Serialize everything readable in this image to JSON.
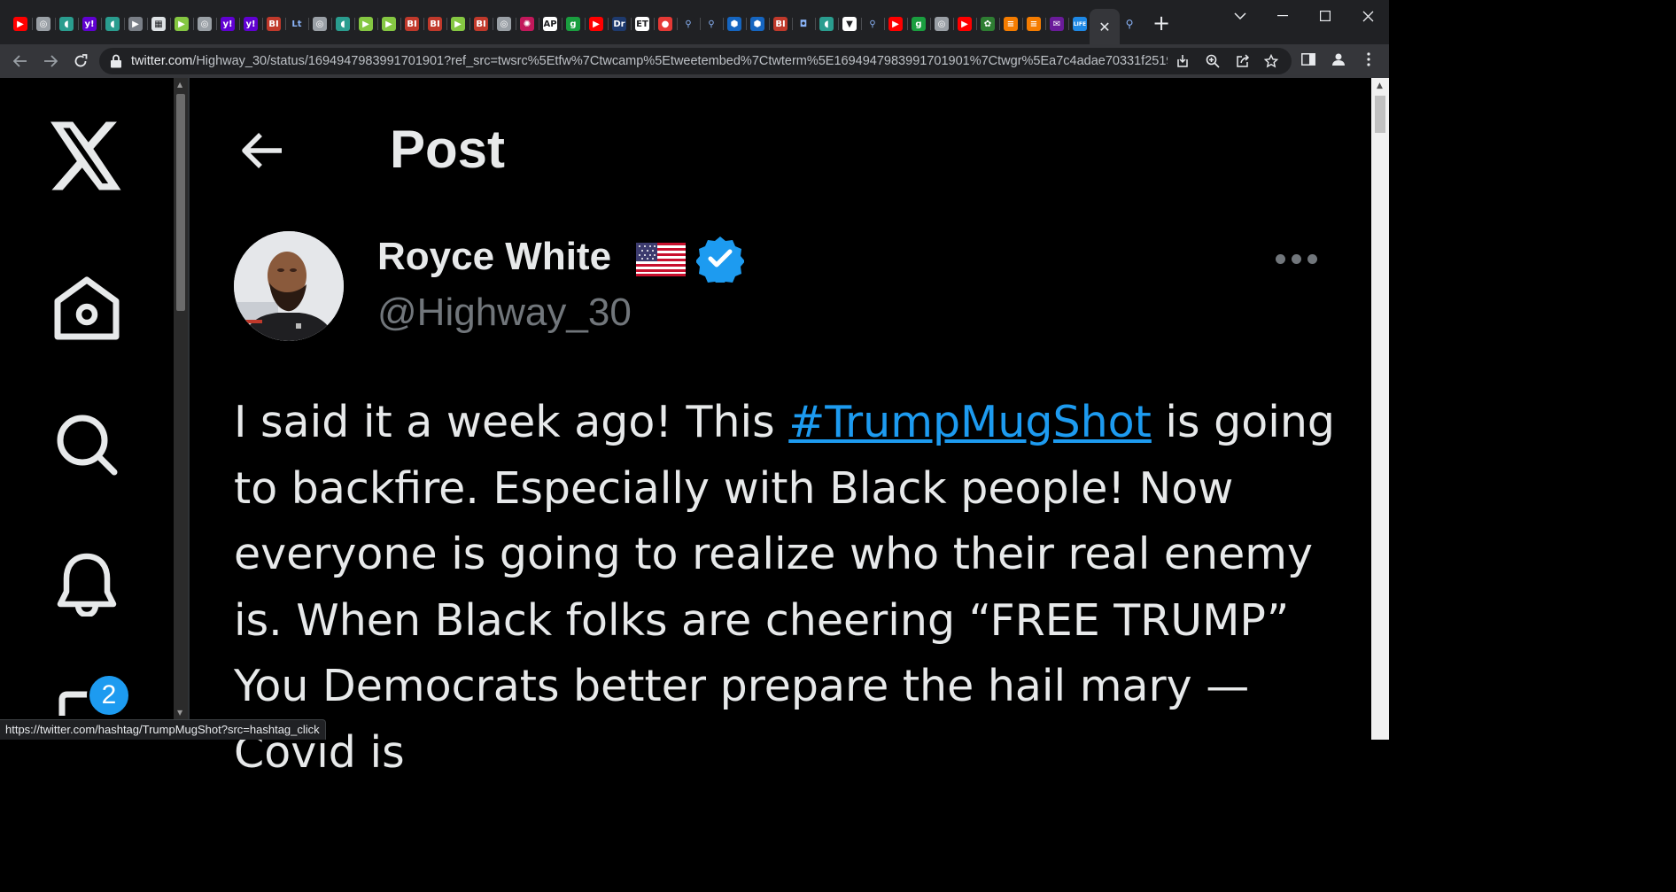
{
  "browser": {
    "url_host": "twitter.com",
    "url_path": "/Highway_30/status/1694947983991701901?ref_src=twsrc%5Etfw%7Ctwcamp%5Etweetembed%7Ctwterm%5E1694947983991701901%7Ctwgr%5Ea7c4adae70331f25193...",
    "tabs": [
      {
        "icon": "youtube-icon",
        "color": "#ff0000",
        "glyph": "▶"
      },
      {
        "icon": "globe-icon",
        "color": "#9aa0a6",
        "glyph": "◎"
      },
      {
        "icon": "shield-icon",
        "color": "#2a9d8f",
        "glyph": "◖"
      },
      {
        "icon": "yahoo-icon",
        "color": "#6001d2",
        "glyph": "y!"
      },
      {
        "icon": "shield-icon",
        "color": "#2a9d8f",
        "glyph": "◖"
      },
      {
        "icon": "tag-icon",
        "color": "#7a7f87",
        "glyph": "▶"
      },
      {
        "icon": "qr-icon",
        "color": "#dfe3e6",
        "glyph": "▦"
      },
      {
        "icon": "rumble-icon",
        "color": "#85c742",
        "glyph": "▶"
      },
      {
        "icon": "globe-icon",
        "color": "#9aa0a6",
        "glyph": "◎"
      },
      {
        "icon": "yahoo-icon",
        "color": "#6001d2",
        "glyph": "y!"
      },
      {
        "icon": "yahoo-icon",
        "color": "#6001d2",
        "glyph": "y!"
      },
      {
        "icon": "bi-icon",
        "color": "#c0392b",
        "glyph": "BI"
      },
      {
        "icon": "serif-logo-icon",
        "color": "#202124",
        "glyph": "Lt"
      },
      {
        "icon": "globe-icon",
        "color": "#9aa0a6",
        "glyph": "◎"
      },
      {
        "icon": "shield-icon",
        "color": "#2a9d8f",
        "glyph": "◖"
      },
      {
        "icon": "rumble-icon",
        "color": "#85c742",
        "glyph": "▶"
      },
      {
        "icon": "rumble-icon",
        "color": "#85c742",
        "glyph": "▶"
      },
      {
        "icon": "bi-icon",
        "color": "#c0392b",
        "glyph": "BI"
      },
      {
        "icon": "bi-icon",
        "color": "#c0392b",
        "glyph": "BI"
      },
      {
        "icon": "rumble-icon",
        "color": "#85c742",
        "glyph": "▶"
      },
      {
        "icon": "bi-icon",
        "color": "#c0392b",
        "glyph": "BI"
      },
      {
        "icon": "globe-icon",
        "color": "#9aa0a6",
        "glyph": "◎"
      },
      {
        "icon": "spiral-icon",
        "color": "#c2185b",
        "glyph": "✺"
      },
      {
        "icon": "news-icon",
        "color": "#ffffff",
        "glyph": "AP"
      },
      {
        "icon": "gettr-icon",
        "color": "#1a9e3f",
        "glyph": "g"
      },
      {
        "icon": "youtube-icon",
        "color": "#ff0000",
        "glyph": "▶"
      },
      {
        "icon": "dr-icon",
        "color": "#1e3a6e",
        "glyph": "Dr"
      },
      {
        "icon": "et-icon",
        "color": "#ffffff",
        "glyph": "ET"
      },
      {
        "icon": "mic-icon",
        "color": "#e53935",
        "glyph": "●"
      },
      {
        "icon": "search-icon",
        "color": "#202124",
        "glyph": "⚲"
      },
      {
        "icon": "search-icon",
        "color": "#202124",
        "glyph": "⚲"
      },
      {
        "icon": "hex-icon",
        "color": "#1565c0",
        "glyph": "⬢"
      },
      {
        "icon": "hex-icon",
        "color": "#1565c0",
        "glyph": "⬢"
      },
      {
        "icon": "bi-icon",
        "color": "#c0392b",
        "glyph": "BI"
      },
      {
        "icon": "shield-outline-icon",
        "color": "#202124",
        "glyph": "◘"
      },
      {
        "icon": "shield-icon",
        "color": "#2a9d8f",
        "glyph": "◖"
      },
      {
        "icon": "crest-icon",
        "color": "#ffffff",
        "glyph": "▼"
      },
      {
        "icon": "search-icon",
        "color": "#202124",
        "glyph": "⚲"
      },
      {
        "icon": "youtube-icon",
        "color": "#ff0000",
        "glyph": "▶"
      },
      {
        "icon": "gettr-icon",
        "color": "#1a9e3f",
        "glyph": "g"
      },
      {
        "icon": "globe-icon",
        "color": "#9aa0a6",
        "glyph": "◎"
      },
      {
        "icon": "youtube-icon",
        "color": "#ff0000",
        "glyph": "▶"
      },
      {
        "icon": "leaf-icon",
        "color": "#2e7d32",
        "glyph": "✿"
      },
      {
        "icon": "bookmark-icon",
        "color": "#f57c00",
        "glyph": "≡"
      },
      {
        "icon": "bookmark-icon",
        "color": "#f57c00",
        "glyph": "≡"
      },
      {
        "icon": "mail-icon",
        "color": "#6a1b9a",
        "glyph": "✉"
      },
      {
        "icon": "life-icon",
        "color": "#1e88e5",
        "glyph": "LIFE"
      }
    ]
  },
  "sidebar": {
    "badge_count": "2"
  },
  "header": {
    "title": "Post"
  },
  "author": {
    "name": "Royce White",
    "handle": "@Highway_30"
  },
  "tweet": {
    "text_before": "I said it a week ago! This ",
    "hashtag": "#TrumpMugShot",
    "text_after": " is going to backfire. Especially with Black people! Now everyone is going to realize who their real enemy is. When Black folks are cheering “FREE TRUMP” You Democrats better prepare the hail mary — Covid is"
  },
  "status_bar": {
    "link": "https://twitter.com/hashtag/TrumpMugShot?src=hashtag_click"
  },
  "colors": {
    "accent": "#1d9bf0",
    "text_primary": "#e7e9ea",
    "text_secondary": "#71767b",
    "background": "#000000"
  }
}
